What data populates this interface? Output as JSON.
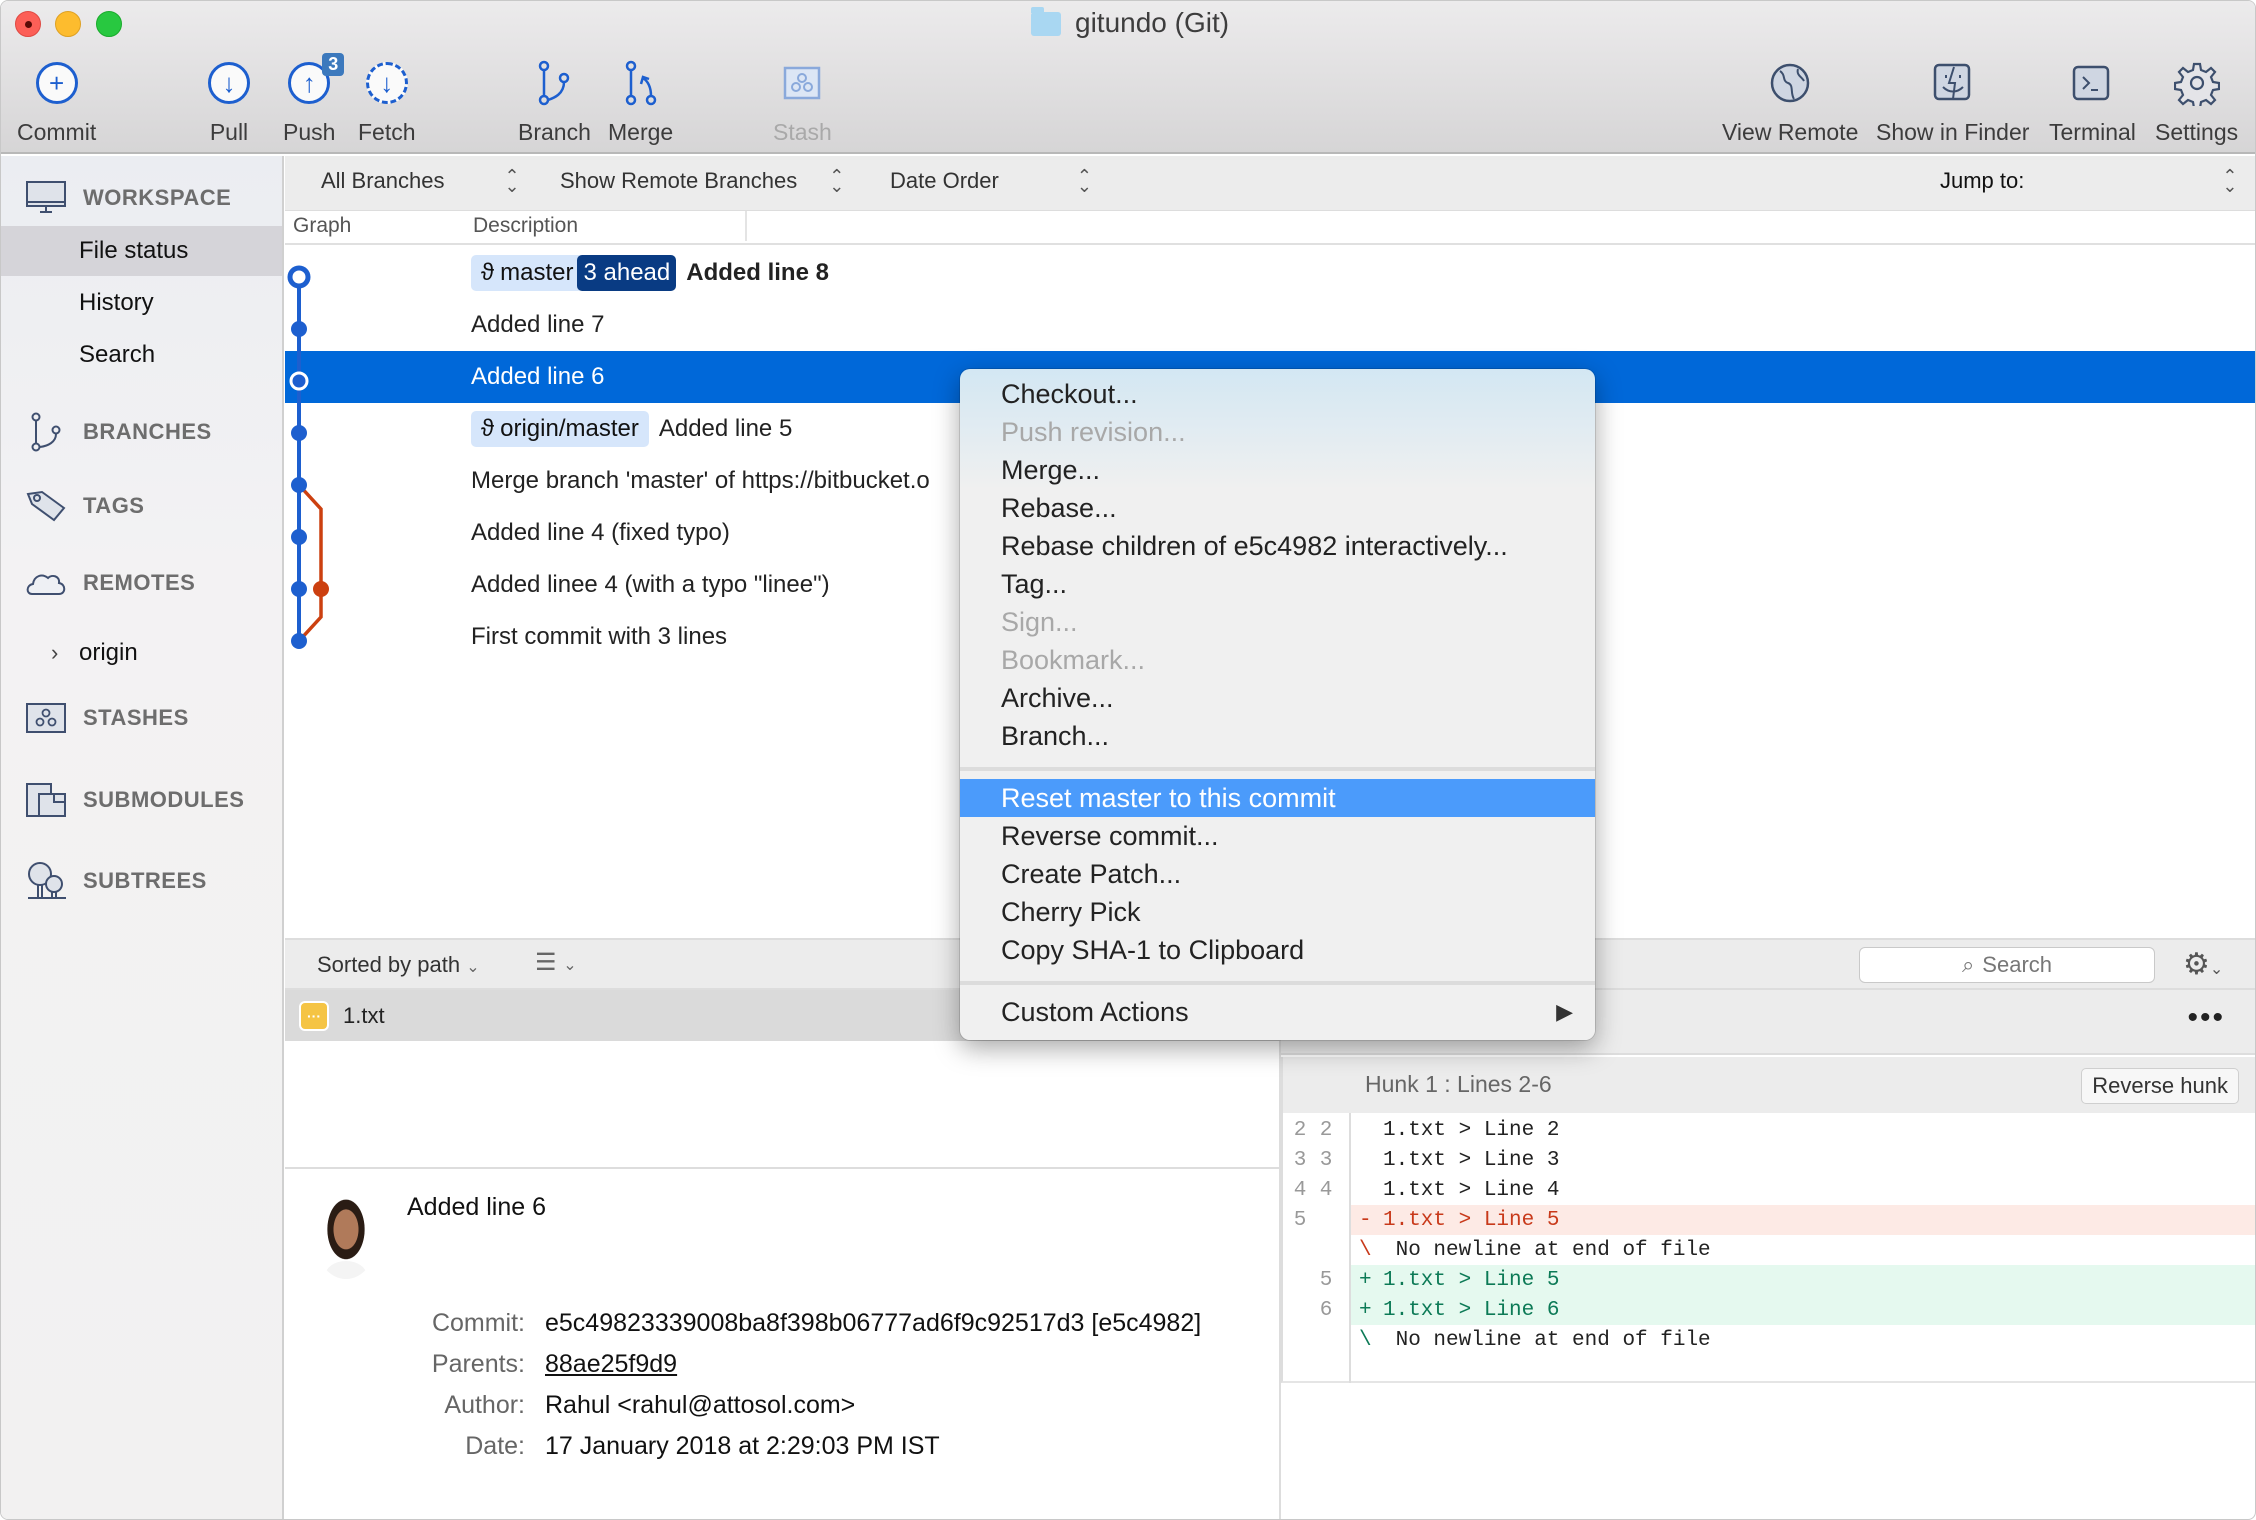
{
  "window": {
    "title": "gitundo (Git)"
  },
  "toolbar": {
    "left": [
      {
        "label": "Commit",
        "icon": "commit-plus-icon"
      },
      {
        "label": "Pull",
        "icon": "pull-arrow-down-icon"
      },
      {
        "label": "Push",
        "icon": "push-arrow-up-icon",
        "badge": "3"
      },
      {
        "label": "Fetch",
        "icon": "fetch-dashed-icon"
      },
      {
        "label": "Branch",
        "icon": "branch-icon"
      },
      {
        "label": "Merge",
        "icon": "merge-icon"
      },
      {
        "label": "Stash",
        "icon": "stash-icon",
        "disabled": true
      }
    ],
    "right": [
      {
        "label": "View Remote",
        "icon": "globe-icon"
      },
      {
        "label": "Show in Finder",
        "icon": "finder-icon"
      },
      {
        "label": "Terminal",
        "icon": "terminal-icon"
      },
      {
        "label": "Settings",
        "icon": "gear-icon"
      }
    ]
  },
  "sidebar": {
    "workspace": {
      "label": "WORKSPACE",
      "items": [
        "File status",
        "History",
        "Search"
      ],
      "selected": "File status"
    },
    "branches": "BRANCHES",
    "tags": "TAGS",
    "remotes": {
      "label": "REMOTES",
      "items": [
        "origin"
      ]
    },
    "stashes": "STASHES",
    "submodules": "SUBMODULES",
    "subtrees": "SUBTREES"
  },
  "filters": {
    "branches": "All Branches",
    "remote": "Show Remote Branches",
    "order": "Date Order",
    "jump": "Jump to:"
  },
  "columns": {
    "graph": "Graph",
    "description": "Description"
  },
  "commits": [
    {
      "refs": [
        {
          "name": "master",
          "ahead": "3 ahead"
        }
      ],
      "message": "Added line 8",
      "bold": true
    },
    {
      "message": "Added line 7"
    },
    {
      "message": "Added line 6",
      "selected": true
    },
    {
      "refs": [
        {
          "name": "origin/master"
        }
      ],
      "message": "Added line 5"
    },
    {
      "message": "Merge branch 'master' of https://bitbucket.o"
    },
    {
      "message": "Added line 4 (fixed typo)"
    },
    {
      "message": "Added linee 4 (with a typo \"linee\")"
    },
    {
      "message": "First commit with 3 lines"
    }
  ],
  "context_menu": {
    "groups": [
      [
        {
          "label": "Checkout..."
        },
        {
          "label": "Push revision...",
          "disabled": true
        },
        {
          "label": "Merge..."
        },
        {
          "label": "Rebase..."
        },
        {
          "label": "Rebase children of e5c4982 interactively..."
        },
        {
          "label": "Tag..."
        },
        {
          "label": "Sign...",
          "disabled": true
        },
        {
          "label": "Bookmark...",
          "disabled": true
        },
        {
          "label": "Archive..."
        },
        {
          "label": "Branch..."
        }
      ],
      [
        {
          "label": "Reset master to this commit",
          "highlighted": true
        },
        {
          "label": "Reverse commit..."
        },
        {
          "label": "Create Patch..."
        },
        {
          "label": "Cherry Pick"
        },
        {
          "label": "Copy SHA-1 to Clipboard"
        }
      ],
      [
        {
          "label": "Custom Actions",
          "submenu": true
        }
      ]
    ]
  },
  "files": {
    "sort_label": "Sorted by path",
    "items": [
      {
        "name": "1.txt",
        "status": "modified"
      }
    ]
  },
  "commit_details": {
    "title": "Added line 6",
    "commit_label": "Commit:",
    "commit": "e5c49823339008ba8f398b06777ad6f9c92517d3 [e5c4982]",
    "parents_label": "Parents:",
    "parents": "88ae25f9d9",
    "author_label": "Author:",
    "author": "Rahul <rahul@attosol.com>",
    "date_label": "Date:",
    "date": "17 January 2018 at 2:29:03 PM IST"
  },
  "diff": {
    "search_placeholder": "Search",
    "hunk_title": "Hunk 1 : Lines 2-6",
    "reverse_label": "Reverse hunk",
    "lines": [
      {
        "old": "2",
        "new": "2",
        "sign": "",
        "text": "1.txt > Line 2",
        "type": "ctx"
      },
      {
        "old": "3",
        "new": "3",
        "sign": "",
        "text": "1.txt > Line 3",
        "type": "ctx"
      },
      {
        "old": "4",
        "new": "4",
        "sign": "",
        "text": "1.txt > Line 4",
        "type": "ctx"
      },
      {
        "old": "5",
        "new": "",
        "sign": "-",
        "text": "1.txt > Line 5",
        "type": "del"
      },
      {
        "old": "",
        "new": "",
        "sign": "\\",
        "text": " No newline at end of file",
        "type": "note"
      },
      {
        "old": "",
        "new": "5",
        "sign": "+",
        "text": "1.txt > Line 5",
        "type": "add"
      },
      {
        "old": "",
        "new": "6",
        "sign": "+",
        "text": "1.txt > Line 6",
        "type": "add"
      },
      {
        "old": "",
        "new": "",
        "sign": "\\",
        "text": " No newline at end of file",
        "type": "note-g"
      }
    ]
  },
  "colors": {
    "accent": "#0068d9",
    "menu_highlight": "#4b9bfb",
    "graph_main": "#1d5fcf",
    "graph_branch": "#cc4010",
    "ahead_badge": "#093b83"
  }
}
